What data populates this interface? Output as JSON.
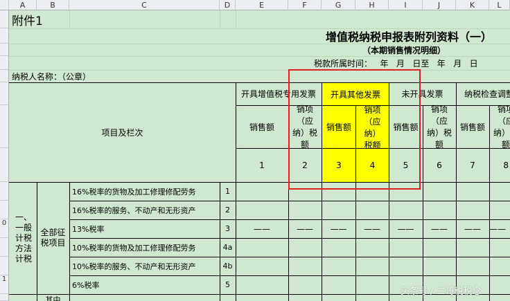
{
  "col_headers": [
    "A",
    "B",
    "C",
    "D",
    "E",
    "F",
    "G",
    "H",
    "I",
    "J",
    "K",
    "L"
  ],
  "row_headers": [
    "",
    "",
    "",
    "",
    "",
    "",
    "",
    "",
    "",
    "",
    "",
    "0",
    "",
    "",
    "",
    "1"
  ],
  "sheet": {
    "fujian": "附件1",
    "title": "增值税纳税申报表附列资料（一）",
    "subtitle": "（本期销售情况明细）",
    "period": "税款所属时间：   年   月   日至   年   月   日",
    "taxpayer": "纳税人名称：（公章）",
    "item_label": "项目及栏次",
    "groups": [
      "开具增值税专用发票",
      "开具其他发票",
      "未开具发票",
      "纳税检查调整"
    ],
    "sub_sales": "销售额",
    "sub_tax": "销项（应纳）税额",
    "col_nums": [
      "1",
      "2",
      "3",
      "4",
      "5",
      "6",
      "7",
      "8"
    ],
    "section_main": "一、一般计税方法计税",
    "section_sub": "全部征税项目",
    "section_next": "其中",
    "rows": [
      {
        "label": "16%税率的货物及加工修理修配劳务",
        "num": "1"
      },
      {
        "label": "16%税率的服务、不动产和无形资产",
        "num": "2"
      },
      {
        "label": "13%税率",
        "num": "3"
      },
      {
        "label": "10%税率的货物及加工修理修配劳务",
        "num": "4a"
      },
      {
        "label": "10%税率的服务、不动产和无形资产",
        "num": "4b"
      },
      {
        "label": "6%税率",
        "num": "5"
      }
    ],
    "dash": "——"
  },
  "watermark": "头条号 / 二哥税税念",
  "colors": {
    "sheet_bg": "#cfe8cf",
    "highlight": "#ffff00",
    "annotation": "#e02020"
  }
}
